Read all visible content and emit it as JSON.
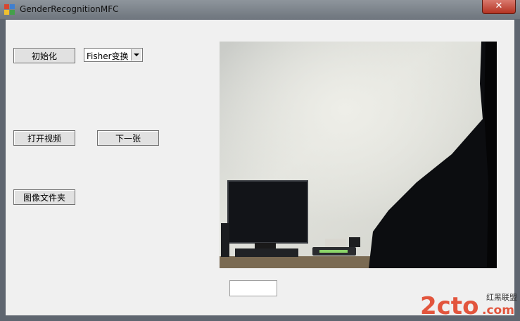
{
  "window": {
    "title": "GenderRecognitionMFC",
    "close_label": "✕"
  },
  "buttons": {
    "init": "初始化",
    "open_video": "打开视频",
    "next": "下一张",
    "image_folder": "图像文件夹"
  },
  "combo": {
    "selected": "Fisher变换"
  },
  "result_box": {
    "value": ""
  },
  "watermark": {
    "main": "2cto",
    "suffix": ".com",
    "tag": "红黑联盟"
  },
  "colors": {
    "client_bg": "#f0f0f0",
    "close_red": "#c0392b",
    "watermark_red": "#e03a1e"
  }
}
